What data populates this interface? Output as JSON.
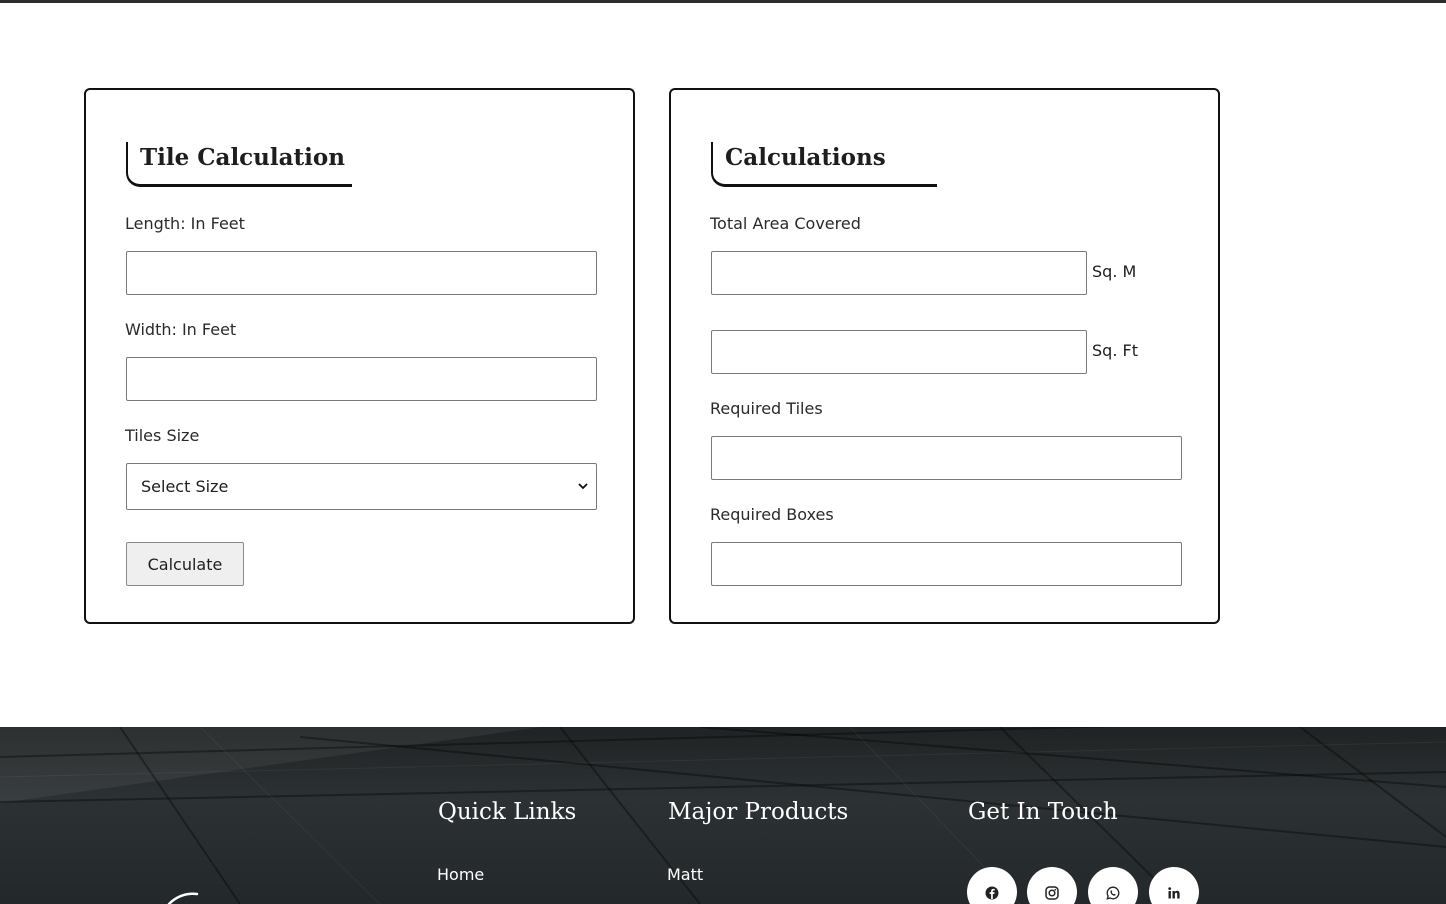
{
  "tile_calc": {
    "title": "Tile Calculation",
    "length_label": "Length: In Feet",
    "length_value": "",
    "width_label": "Width: In Feet",
    "width_value": "",
    "tiles_size_label": "Tiles Size",
    "tiles_size_selected": "Select Size",
    "calculate_label": "Calculate"
  },
  "calculations": {
    "title": "Calculations",
    "total_area_label": "Total Area Covered",
    "sqm_value": "",
    "sqm_unit": "Sq. M",
    "sqft_value": "",
    "sqft_unit": "Sq. Ft",
    "required_tiles_label": "Required Tiles",
    "required_tiles_value": "",
    "required_boxes_label": "Required Boxes",
    "required_boxes_value": ""
  },
  "footer": {
    "quick_links_heading": "Quick Links",
    "quick_links": [
      "Home"
    ],
    "major_products_heading": "Major Products",
    "major_products": [
      "Matt"
    ],
    "get_in_touch_heading": "Get In Touch",
    "social_icons": [
      "facebook-icon",
      "instagram-icon",
      "whatsapp-icon",
      "linkedin-icon"
    ]
  }
}
